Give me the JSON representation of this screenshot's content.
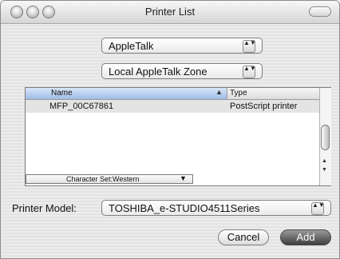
{
  "window": {
    "title": "Printer List"
  },
  "connection_popup": {
    "selected": "AppleTalk",
    "arrows": "▲▼"
  },
  "zone_popup": {
    "selected": "Local AppleTalk Zone",
    "arrows": "▲▼"
  },
  "printer_list": {
    "columns": {
      "name": "Name",
      "type": "Type"
    },
    "sort_indicator": "▲",
    "rows": [
      {
        "name": "MFP_00C67861",
        "type": "PostScript printer"
      }
    ],
    "charset": {
      "label": "Character Set:Western",
      "arrow": "▼"
    },
    "scroll_up": "▲",
    "scroll_down": "▼"
  },
  "printer_model": {
    "label": "Printer Model:",
    "selected": "TOSHIBA_e-STUDIO4511Series",
    "arrows": "▲▼"
  },
  "buttons": {
    "cancel": "Cancel",
    "add": "Add"
  }
}
